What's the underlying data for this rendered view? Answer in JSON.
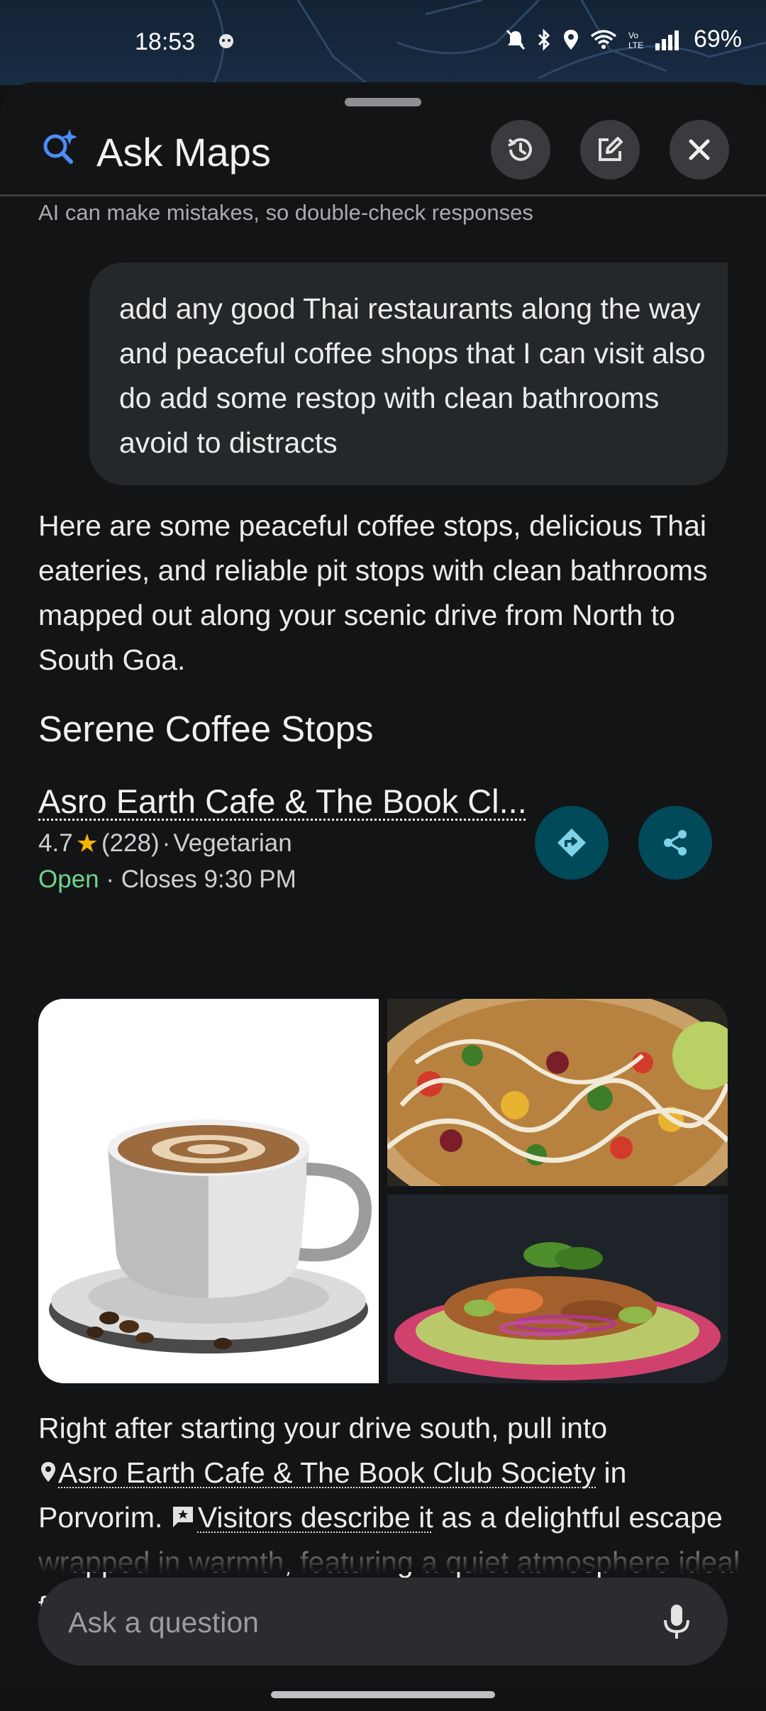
{
  "status_bar": {
    "time": "18:53",
    "battery": "69%"
  },
  "header": {
    "title": "Ask Maps",
    "disclaimer": "AI can make mistakes, so double-check responses"
  },
  "user_message": "add any good Thai restaurants along the way and peaceful coffee shops that I can visit also do add some restop with clean bathrooms avoid to distracts",
  "answer_intro": "Here are some peaceful coffee stops, delicious Thai eateries, and reliable pit stops with clean bathrooms mapped out along your scenic drive from North to South Goa.",
  "section": {
    "title": "Serene Coffee Stops",
    "place": {
      "name": "Asro Earth Cafe & The Book Cl...",
      "rating": "4.7",
      "reviews": "(228)",
      "category": "Vegetarian",
      "status": "Open",
      "closes": "Closes 9:30 PM"
    }
  },
  "body": {
    "p1": "Right after starting your drive south, pull into",
    "place_link": "Asro Earth Cafe & The Book Club Society",
    "p2": " in Porvorim. ",
    "visitors_link": "Visitors describe it",
    "p3": " as a delightful escape wrapped in warmth, featuring a quiet atmosphere ideal for nursing an aromatic coffee"
  },
  "input": {
    "placeholder": "Ask a question"
  },
  "colors": {
    "accent": "#4c8df6",
    "open": "#6dd58c",
    "action_bg": "#004a5a",
    "star": "#f4b400"
  }
}
